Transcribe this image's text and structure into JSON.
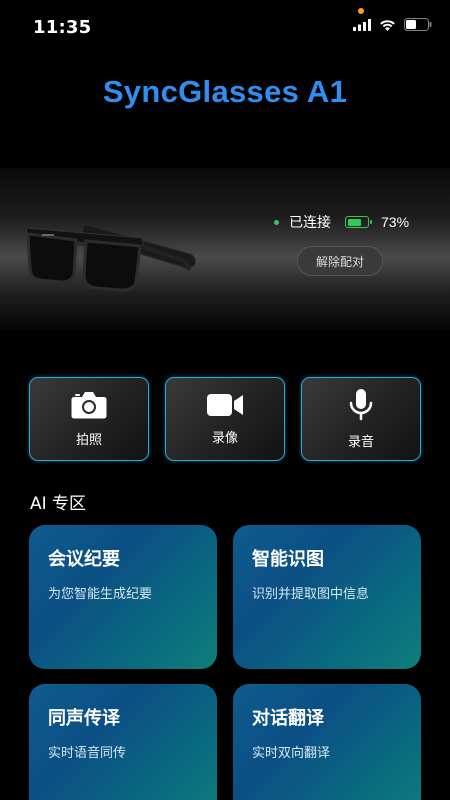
{
  "status_bar": {
    "time": "11:35",
    "icons": [
      "cellular-signal-icon",
      "wifi-icon",
      "battery-icon"
    ]
  },
  "app": {
    "title": "SyncGlasses A1"
  },
  "device": {
    "connection_status": "已连接",
    "battery_percent": "73%",
    "battery_level": 0.73,
    "unpair_label": "解除配对"
  },
  "actions": [
    {
      "label": "拍照",
      "icon": "camera-icon"
    },
    {
      "label": "录像",
      "icon": "video-camera-icon"
    },
    {
      "label": "录音",
      "icon": "microphone-icon"
    }
  ],
  "ai_section": {
    "title": "AI 专区",
    "cards": [
      {
        "title": "会议纪要",
        "subtitle": "为您智能生成纪要"
      },
      {
        "title": "智能识图",
        "subtitle": "识别并提取图中信息"
      },
      {
        "title": "同声传译",
        "subtitle": "实时语音同传"
      },
      {
        "title": "对话翻译",
        "subtitle": "实时双向翻译"
      }
    ]
  },
  "colors": {
    "accent_title": "#2f8ff0",
    "button_border": "#2fa8d8",
    "connected_green": "#34c759",
    "card_gradient_start": "#0e5c8e",
    "card_gradient_end": "#0e7f7a"
  }
}
